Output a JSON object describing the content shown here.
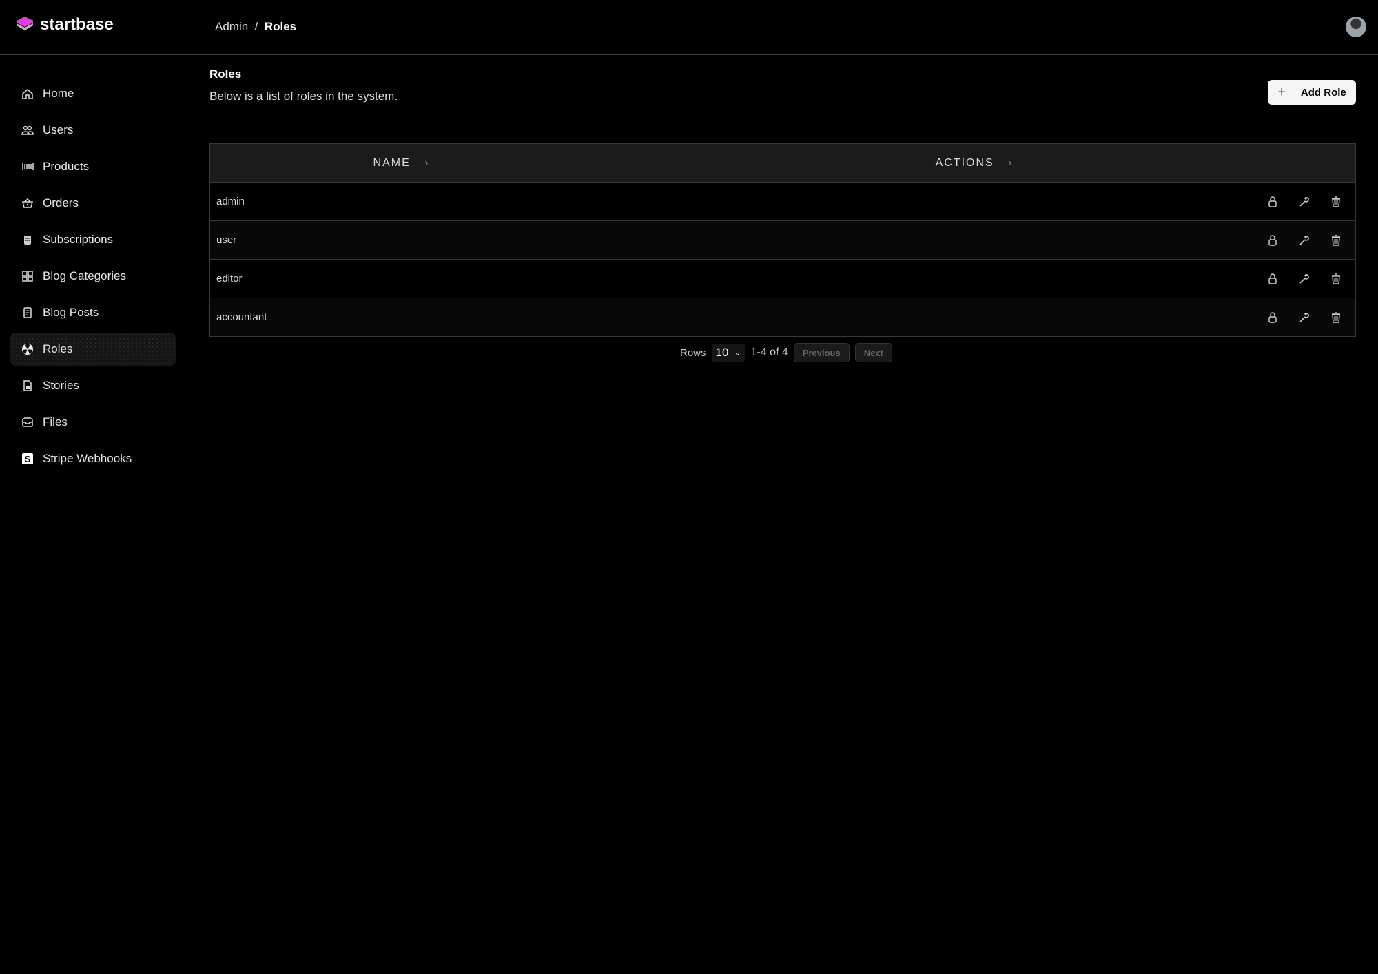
{
  "app": {
    "name": "startbase",
    "brand_color": "#e040e0"
  },
  "breadcrumb": {
    "parent": "Admin",
    "separator": "/",
    "current": "Roles"
  },
  "sidebar": {
    "items": [
      {
        "label": "Home",
        "icon": "home-icon"
      },
      {
        "label": "Users",
        "icon": "users-icon"
      },
      {
        "label": "Products",
        "icon": "barcode-icon"
      },
      {
        "label": "Orders",
        "icon": "basket-icon"
      },
      {
        "label": "Subscriptions",
        "icon": "subscriptions-icon"
      },
      {
        "label": "Blog Categories",
        "icon": "grid-icon"
      },
      {
        "label": "Blog Posts",
        "icon": "document-icon"
      },
      {
        "label": "Roles",
        "icon": "radiation-icon",
        "active": true
      },
      {
        "label": "Stories",
        "icon": "file-lock-icon"
      },
      {
        "label": "Files",
        "icon": "archive-icon"
      },
      {
        "label": "Stripe Webhooks",
        "icon": "stripe-icon"
      }
    ]
  },
  "page": {
    "title": "Roles",
    "description": "Below is a list of roles in the system.",
    "add_button": "Add Role"
  },
  "table": {
    "columns": [
      "NAME",
      "ACTIONS"
    ],
    "rows": [
      {
        "name": "admin"
      },
      {
        "name": "user"
      },
      {
        "name": "editor"
      },
      {
        "name": "accountant"
      }
    ]
  },
  "pagination": {
    "rows_label": "Rows",
    "rows_value": "10",
    "range": "1-4 of 4",
    "previous": "Previous",
    "next": "Next"
  }
}
